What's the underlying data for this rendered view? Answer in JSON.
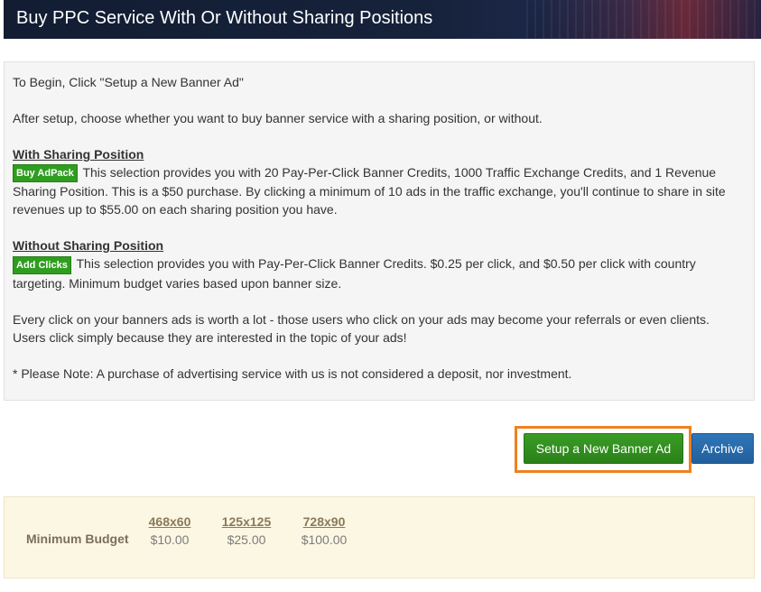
{
  "header": {
    "title": "Buy PPC Service With Or Without Sharing Positions"
  },
  "info": {
    "intro": "To Begin, Click \"Setup a New Banner Ad\"",
    "after_setup": "After setup, choose whether you want to buy banner service with a sharing position, or without.",
    "with_sharing": {
      "title": "With Sharing Position",
      "button_label": "Buy AdPack",
      "text": "This selection provides you with 20 Pay-Per-Click Banner Credits, 1000 Traffic Exchange Credits, and 1 Revenue Sharing Position. This is a $50 purchase. By clicking a minimum of 10 ads in the traffic exchange, you'll continue to share in site revenues up to $55.00 on each sharing position you have."
    },
    "without_sharing": {
      "title": "Without Sharing Position",
      "button_label": "Add Clicks",
      "text": "This selection provides you with Pay-Per-Click Banner Credits. $0.25 per click, and $0.50 per click with country targeting. Minimum budget varies based upon banner size."
    },
    "every_click": "Every click on your banners ads is worth a lot - those users who click on your ads may become your referrals or even clients. Users click simply because they are interested in the topic of your ads!",
    "note": "* Please Note: A purchase of advertising service with us is not considered a deposit, nor investment."
  },
  "actions": {
    "setup_label": "Setup a New Banner Ad",
    "archive_label": "Archive"
  },
  "budget": {
    "label": "Minimum Budget",
    "columns": [
      {
        "size": "468x60",
        "price": "$10.00"
      },
      {
        "size": "125x125",
        "price": "$25.00"
      },
      {
        "size": "728x90",
        "price": "$100.00"
      }
    ]
  },
  "colors": {
    "header_bg": "#16223a",
    "green_button": "#2f9d1f",
    "blue_button": "#225f9c",
    "highlight": "#f0801e",
    "budget_bg": "#fcf7e3"
  }
}
